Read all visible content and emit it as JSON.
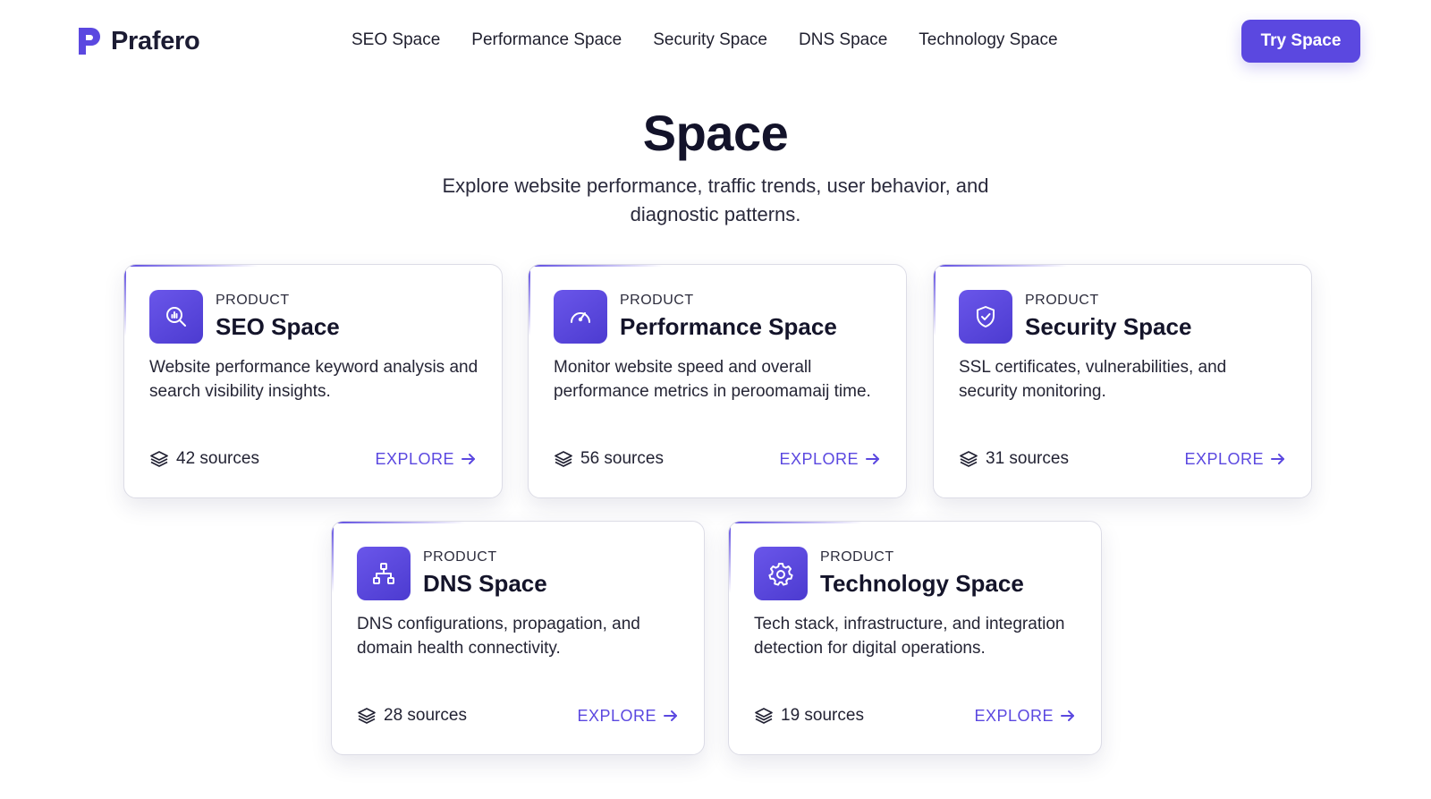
{
  "brand": {
    "name": "Prafero"
  },
  "nav": {
    "items": [
      "SEO Space",
      "Performance Space",
      "Security Space",
      "DNS Space",
      "Technology Space"
    ],
    "cta_label": "Try Space"
  },
  "hero": {
    "title": "Space",
    "subtitle": "Explore website performance, traffic trends, user behavior, and diagnostic patterns."
  },
  "cards": [
    {
      "eyebrow": "PRODUCT",
      "title": "SEO Space",
      "icon": "search-chart-icon",
      "description": "Website performance keyword analysis and search visibility insights.",
      "sources": "42 sources",
      "action": "EXPLORE"
    },
    {
      "eyebrow": "PRODUCT",
      "title": "Performance Space",
      "icon": "speedometer-icon",
      "description": "Monitor website speed and overall performance metrics in peroomamaij time.",
      "sources": "56 sources",
      "action": "EXPLORE"
    },
    {
      "eyebrow": "PRODUCT",
      "title": "Security Space",
      "icon": "shield-check-icon",
      "description": "SSL certificates, vulnerabilities, and security monitoring.",
      "sources": "31 sources",
      "action": "EXPLORE"
    },
    {
      "eyebrow": "PRODUCT",
      "title": "DNS Space",
      "icon": "network-tree-icon",
      "description": "DNS configurations, propagation, and domain health connectivity.",
      "sources": "28 sources",
      "action": "EXPLORE"
    },
    {
      "eyebrow": "PRODUCT",
      "title": "Technology Space",
      "icon": "gear-icon",
      "description": "Tech stack, infrastructure, and integration detection for digital operations.",
      "sources": "19 sources",
      "action": "EXPLORE"
    }
  ],
  "colors": {
    "accent": "#5b48e0",
    "text": "#14142a",
    "border": "#dcdce6"
  }
}
